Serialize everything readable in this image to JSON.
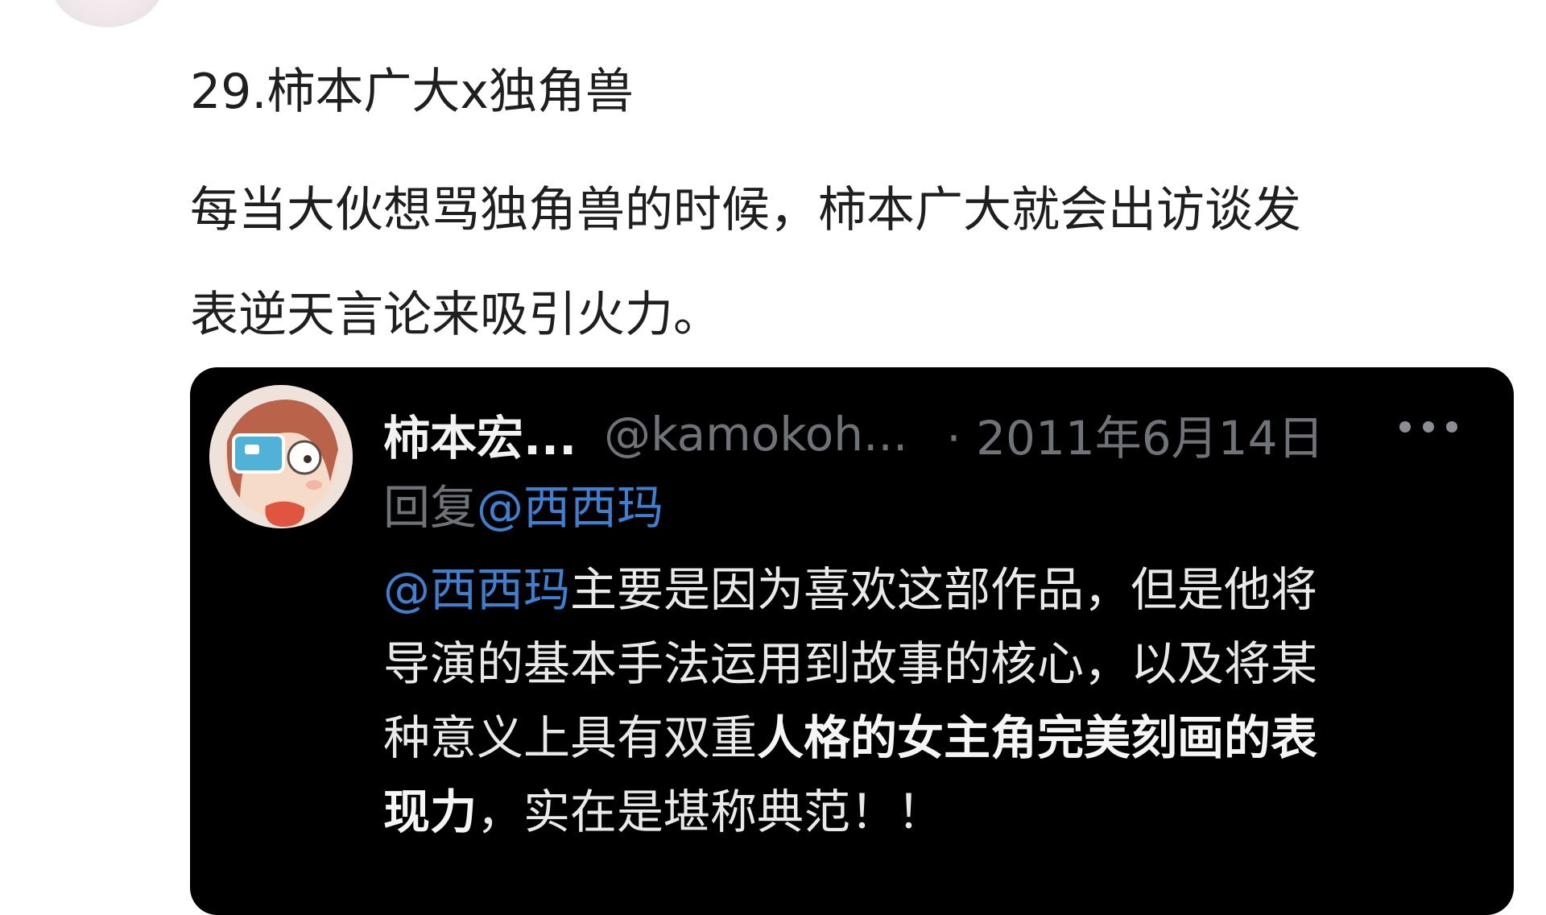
{
  "post": {
    "title": "29.柿本广大x独角兽",
    "body_lines": [
      "每当大伙想骂独角兽的时候，柿本广大就会出访谈发",
      "表逆天言论来吸引火力。"
    ]
  },
  "tweet": {
    "display_name": "柿本宏...",
    "handle": "@kamokoh...",
    "date": "· 2011年6月14日",
    "more_icon": "more-horizontal-icon",
    "reply_prefix": "回复",
    "reply_mention": "@西西玛",
    "text": {
      "line1_mention": "@西西玛",
      "line1_rest": "主要是因为喜欢这部作品，但是他将",
      "line2": "导演的基本手法运用到故事的核心，以及将某",
      "line3_normal": "种意义上具有双重",
      "line3_bold": "人格的女主角完美刻画的表",
      "line4_bold": "现力",
      "line4_rest": "，实在是堪称典范！！"
    }
  },
  "colors": {
    "background": "#ffffff",
    "card": "#000000",
    "mention": "#3f7fcf",
    "secondary_text": "#6f7377"
  }
}
